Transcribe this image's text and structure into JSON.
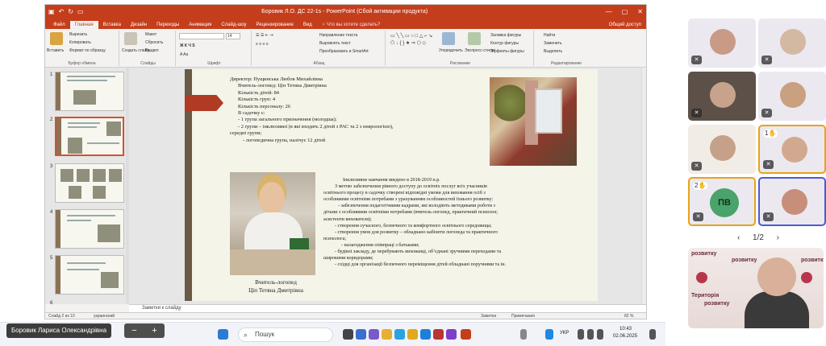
{
  "window": {
    "title": "Боровик Л.О. ДС 22-1s - PowerPoint (Сбой активации продукта)",
    "controls": [
      "—",
      "▢",
      "✕"
    ]
  },
  "ribbon_tabs": [
    "Файл",
    "Главная",
    "Вставка",
    "Дизайн",
    "Переходы",
    "Анимация",
    "Слайд-шоу",
    "Рецензирование",
    "Вид"
  ],
  "tell_me": "♀ Что вы хотите сделать?",
  "share": "Общий доступ",
  "clipboard": {
    "paste": "Вставить",
    "cut": "Вырезать",
    "copy": "Копировать",
    "format": "Формат по образцу",
    "label": "Буфер обмена"
  },
  "slides_group": {
    "new": "Создать слайд",
    "layout": "Макет",
    "reset": "Сбросить",
    "section": "Раздел",
    "label": "Слайды"
  },
  "font_group": {
    "size": "14",
    "label": "Шрифт"
  },
  "paragraph_group": {
    "direction": "Направление текста",
    "align": "Выровнять текст",
    "smartart": "Преобразовать в SmartArt",
    "label": "Абзац"
  },
  "drawing_group": {
    "arrange": "Упорядочить",
    "quick": "Экспресс-стили",
    "fill": "Заливка фигуры",
    "outline": "Контур фигуры",
    "effects": "Эффекты фигуры",
    "label": "Рисование"
  },
  "editing_group": {
    "find": "Найти",
    "replace": "Заменить",
    "select": "Выделить",
    "label": "Редактирование"
  },
  "thumbnails": {
    "numbers": [
      "1",
      "2",
      "3",
      "4",
      "5",
      "6"
    ]
  },
  "slide": {
    "lines_top": [
      "Директор: Пущинська Любов Михайлівна",
      "Вчитель-логопед: Ціп Тетяна Дмитрівна",
      "Кількість дітей: 84",
      "Кількість груп: 4",
      "Кількість персоналу: 26",
      "В садочку є:",
      "- 1 група загального  призначення (молодша);",
      "- 2 групи – інклюзивні (в які входять 2 дітей з РАС та 2 з неврологією),",
      "середні групи;",
      "- логопедична   група, налічує 12 дітей"
    ],
    "lines_body": [
      "Інклюзивне навчання введено в 2018-2019 н.р.",
      "З метою забезпечення рівного доступу до освітніх послуг всіх учасників",
      "освітнього процесу в садочку створені відповідні умови для виховання осіб з",
      "особливими освітніми потребами з урахуванням особливостей їхнього розвитку:",
      "- забезпечення педагогічними кадрами, які володіють методиками роботи з",
      "дітьми з особливими освітніми потребами (вчитель-логопед, практичний психолог,",
      "асистенти вихователя);",
      "- створення сучасного, безпечного та комфортного освітнього середовища;",
      "- створення умов для розвитку – обладнано кабінети логопеда та практичного",
      "психолога;",
      "- налагодження співпраці з батьками;",
      "- будівлі закладу, де перебувають вихованці, об’єднані зручними переходами та",
      "широкими коридорами;",
      "- східці для організації безпечного переміщення дітей обладнані поручнями та ін."
    ],
    "caption1": "Вчитель-логопед",
    "caption2": "Ціп Тетяна Дмитрівна"
  },
  "notes": "Заметки к слайду",
  "status": {
    "slide": "Слайд 2 из 10",
    "lang": "украинский",
    "notes_btn": "Заметки",
    "comments_btn": "Примечания",
    "zoom": "82 %"
  },
  "participants": {
    "hand1": "1✋",
    "hand2": "2✋",
    "initials": "ПВ",
    "page": "1/2",
    "banner1": "розвитку",
    "banner2": "Територія",
    "banner3": "розвитку"
  },
  "meeting": {
    "name": "Боровик Лариса Олександрівна",
    "zoom_out": "−",
    "zoom_in": "+"
  },
  "taskbar": {
    "search": "Пошук",
    "lang": "УКР",
    "time": "10:43",
    "date": "02.06.2025"
  },
  "colors": {
    "ppt_red": "#c43e1c",
    "speaker_border": "#e7a318",
    "selected_border": "#4a5ad8"
  }
}
